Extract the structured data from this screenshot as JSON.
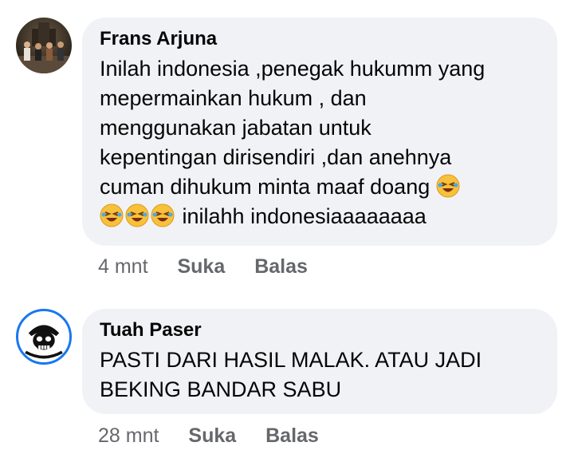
{
  "comments": [
    {
      "author": "Frans Arjuna",
      "lines": [
        "Inilah indonesia ,penegak hukumm yang",
        "mepermainkan hukum , dan",
        "menggunakan jabatan untuk",
        "kepentingan dirisendiri ,dan anehnya",
        "cuman dihukum minta maaf doang",
        "inilahh indonesiaaaaaaaa"
      ],
      "emojis": [
        "rolling-on-floor-laughing-emoji",
        "rolling-on-floor-laughing-emoji",
        "rolling-on-floor-laughing-emoji",
        "rolling-on-floor-laughing-emoji"
      ],
      "time": "4 mnt",
      "like_label": "Suka",
      "reply_label": "Balas"
    },
    {
      "author": "Tuah Paser",
      "lines": [
        "PASTI DARI HASIL MALAK. ATAU JADI",
        "BEKING BANDAR SABU"
      ],
      "time": "28 mnt",
      "like_label": "Suka",
      "reply_label": "Balas"
    }
  ],
  "colors": {
    "bubble": "#f0f2f5",
    "text": "#050505",
    "meta": "#65676b",
    "avatar_ring": "#1877f2"
  }
}
